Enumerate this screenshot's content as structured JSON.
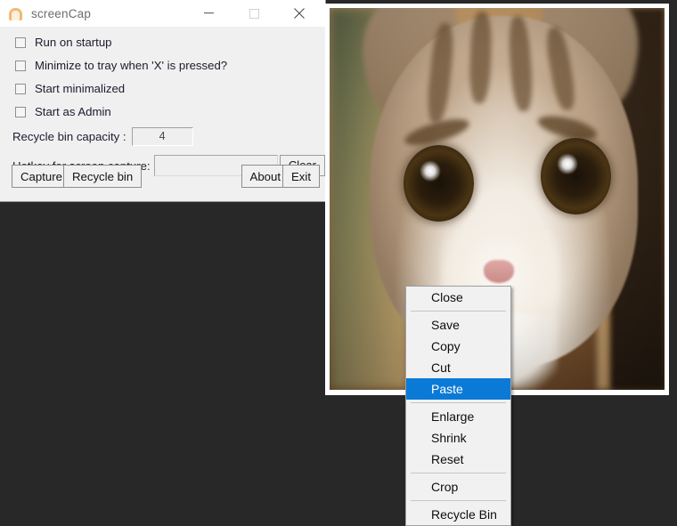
{
  "settings_window": {
    "title": "screenCap",
    "icon": "bread-toast-icon",
    "controls": {
      "minimize": "minimize-icon",
      "maximize": "maximize-icon",
      "close": "close-icon"
    },
    "checkboxes": [
      {
        "label": "Run on startup",
        "checked": false
      },
      {
        "label": "Minimize to tray when 'X' is pressed?",
        "checked": false
      },
      {
        "label": "Start minimalized",
        "checked": false
      },
      {
        "label": "Start as Admin",
        "checked": false
      }
    ],
    "capacity": {
      "label": "Recycle bin capacity :",
      "value": "4"
    },
    "hotkey": {
      "label": "Hotkey for screen capture:",
      "value": "",
      "placeholder": "",
      "clear_label": "Clear"
    },
    "buttons": {
      "capture": "Capture",
      "recycle_bin": "Recycle bin",
      "about": "About",
      "exit": "Exit"
    }
  },
  "image_window": {
    "alt": "close-up photo of a tabby cat face"
  },
  "context_menu": {
    "items": [
      {
        "label": "Close",
        "selected": false,
        "separator_after": true
      },
      {
        "label": "Save",
        "selected": false,
        "separator_after": false
      },
      {
        "label": "Copy",
        "selected": false,
        "separator_after": false
      },
      {
        "label": "Cut",
        "selected": false,
        "separator_after": false
      },
      {
        "label": "Paste",
        "selected": true,
        "separator_after": true
      },
      {
        "label": "Enlarge",
        "selected": false,
        "separator_after": false
      },
      {
        "label": "Shrink",
        "selected": false,
        "separator_after": false
      },
      {
        "label": "Reset",
        "selected": false,
        "separator_after": true
      },
      {
        "label": "Crop",
        "selected": false,
        "separator_after": true
      },
      {
        "label": "Recycle Bin",
        "selected": false,
        "separator_after": false
      }
    ]
  },
  "colors": {
    "desktop_background": "#282828",
    "panel": "#f0f0f0",
    "titlebar": "#ffffff",
    "menu_highlight": "#0b7ad6",
    "title_text": "#6d6d6d"
  }
}
